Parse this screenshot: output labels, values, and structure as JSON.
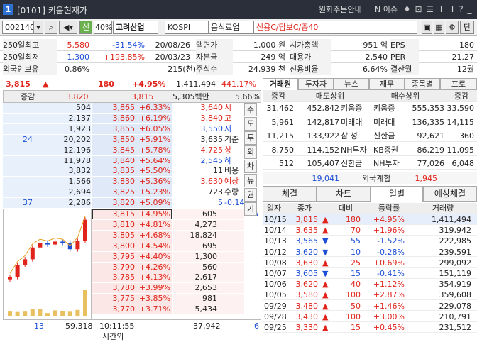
{
  "window": {
    "num": "1",
    "title": "[0101] 키움현재가",
    "notice": "원화주문안내",
    "news": "N 이슈"
  },
  "toolbar": {
    "code": "002140",
    "mode": "신",
    "pct": "40%",
    "name": "고려산업",
    "market": "KOSPI",
    "sector": "음식료업",
    "credit": "신용C/담보C/증40",
    "single": "단"
  },
  "info": {
    "r1": [
      "250일최고",
      "5,580",
      "-31.54%",
      "20/08/26",
      "액면가",
      "1,000 원",
      "시가총액",
      "951 억",
      "EPS",
      "180"
    ],
    "r2": [
      "250일최저",
      "1,300",
      "+193.85%",
      "20/03/23",
      "자본금",
      "249 억",
      "대용가",
      "2,540",
      "PER",
      "21.27"
    ],
    "r3": [
      "외국인보유",
      "0.86%",
      "215(천)",
      "주식수",
      "24,939 천",
      "신용비율",
      "6.64%",
      "결산월",
      "12월"
    ]
  },
  "summary": {
    "price": "3,815",
    "arrow": "▲",
    "diff": "180",
    "rate": "+4.95%",
    "volume": "1,411,494",
    "vr": "441.17%"
  },
  "obhdr": {
    "label": "증감",
    "p1": "3,820",
    "p2": "3,815",
    "amt": "5,305백만",
    "rate": "5.66%"
  },
  "asks": [
    {
      "chg": "",
      "qty": "504",
      "price": "3,865",
      "rate": "+6.33%"
    },
    {
      "chg": "",
      "qty": "2,137",
      "price": "3,860",
      "rate": "+6.19%"
    },
    {
      "chg": "",
      "qty": "1,923",
      "price": "3,855",
      "rate": "+6.05%"
    },
    {
      "chg": "24",
      "qty": "20,202",
      "price": "3,850",
      "rate": "+5.91%"
    },
    {
      "chg": "",
      "qty": "12,196",
      "price": "3,845",
      "rate": "+5.78%"
    },
    {
      "chg": "",
      "qty": "11,978",
      "price": "3,840",
      "rate": "+5.64%"
    },
    {
      "chg": "",
      "qty": "3,832",
      "price": "3,835",
      "rate": "+5.50%"
    },
    {
      "chg": "",
      "qty": "1,566",
      "price": "3,830",
      "rate": "+5.36%"
    },
    {
      "chg": "",
      "qty": "2,694",
      "price": "3,825",
      "rate": "+5.23%"
    },
    {
      "chg": "37",
      "qty": "2,286",
      "price": "3,820",
      "rate": "+5.09%"
    }
  ],
  "quote_info": [
    {
      "val": "3,640",
      "lbl": "시"
    },
    {
      "val": "3,840",
      "lbl": "고"
    },
    {
      "val": "3,550",
      "lbl": "저"
    },
    {
      "val": "3,635",
      "lbl": "기준"
    },
    {
      "val": "4,725",
      "lbl": "상"
    },
    {
      "val": "2,545",
      "lbl": "하"
    },
    {
      "val": "11",
      "lbl": "비용"
    },
    {
      "val": "3,630",
      "lbl": "예상"
    },
    {
      "val": "723",
      "lbl": "수량"
    },
    {
      "val": "5",
      "lbl": "-0.14%"
    }
  ],
  "vtabs": [
    "수",
    "도",
    "투",
    "외",
    "차",
    "뉴",
    "권",
    "기"
  ],
  "bids": [
    {
      "price": "3,815",
      "rate": "+4.95%",
      "qty": "605",
      "chg": "6"
    },
    {
      "price": "3,810",
      "rate": "+4.81%",
      "qty": "4,273",
      "chg": ""
    },
    {
      "price": "3,805",
      "rate": "+4.68%",
      "qty": "18,824",
      "chg": ""
    },
    {
      "price": "3,800",
      "rate": "+4.54%",
      "qty": "695",
      "chg": ""
    },
    {
      "price": "3,795",
      "rate": "+4.40%",
      "qty": "1,300",
      "chg": ""
    },
    {
      "price": "3,790",
      "rate": "+4.26%",
      "qty": "560",
      "chg": ""
    },
    {
      "price": "3,785",
      "rate": "+4.13%",
      "qty": "2,617",
      "chg": ""
    },
    {
      "price": "3,780",
      "rate": "+3.99%",
      "qty": "2,653",
      "chg": ""
    },
    {
      "price": "3,775",
      "rate": "+3.85%",
      "qty": "981",
      "chg": ""
    },
    {
      "price": "3,770",
      "rate": "+3.71%",
      "qty": "5,434",
      "chg": ""
    }
  ],
  "foot": {
    "a": "13",
    "b": "59,318",
    "time": "10:11:55",
    "label": "시간외",
    "c": "37,942",
    "d": "6"
  },
  "rtabs": [
    "거래원",
    "투자자",
    "뉴스",
    "재무",
    "종목별",
    "프로"
  ],
  "broker_hdr": [
    "증감",
    "매도상위",
    "매수상위",
    "증감"
  ],
  "brokers": [
    {
      "c1": "31,462",
      "s": "452,842",
      "sn": "키움증",
      "bn": "키움증",
      "b": "555,353",
      "c2": "33,590"
    },
    {
      "c1": "5,961",
      "s": "142,817",
      "sn": "미래대",
      "bn": "미래대",
      "b": "136,335",
      "c2": "14,115"
    },
    {
      "c1": "11,215",
      "s": "133,922",
      "sn": "삼 성",
      "bn": "신한금",
      "b": "92,621",
      "c2": "360"
    },
    {
      "c1": "8,750",
      "s": "114,152",
      "sn": "NH투자",
      "bn": "KB증권",
      "b": "86,219",
      "c2": "11,095"
    },
    {
      "c1": "512",
      "s": "105,407",
      "sn": "신한금",
      "bn": "NH투자",
      "b": "77,026",
      "c2": "6,048"
    }
  ],
  "foreign": {
    "left": "19,041",
    "label": "외국계합",
    "right": "1,945"
  },
  "mtabs": [
    "체결",
    "차트",
    "일별",
    "예상체결"
  ],
  "daily_hdr": [
    "일자",
    "종가",
    "대비",
    "등락률",
    "거래량"
  ],
  "daily": [
    {
      "d": "10/15",
      "p": "3,815",
      "a": "▲",
      "v": "180",
      "r": "+4.95%",
      "q": "1,411,494",
      "up": true
    },
    {
      "d": "10/14",
      "p": "3,635",
      "a": "▲",
      "v": "70",
      "r": "+1.96%",
      "q": "319,942",
      "up": true
    },
    {
      "d": "10/13",
      "p": "3,565",
      "a": "▼",
      "v": "55",
      "r": "-1.52%",
      "q": "222,985",
      "up": false
    },
    {
      "d": "10/12",
      "p": "3,620",
      "a": "▼",
      "v": "10",
      "r": "-0.28%",
      "q": "239,591",
      "up": false
    },
    {
      "d": "10/08",
      "p": "3,630",
      "a": "▲",
      "v": "25",
      "r": "+0.69%",
      "q": "299,092",
      "up": true
    },
    {
      "d": "10/07",
      "p": "3,605",
      "a": "▼",
      "v": "15",
      "r": "-0.41%",
      "q": "151,119",
      "up": false
    },
    {
      "d": "10/06",
      "p": "3,620",
      "a": "▲",
      "v": "40",
      "r": "+1.12%",
      "q": "354,919",
      "up": true
    },
    {
      "d": "10/05",
      "p": "3,580",
      "a": "▲",
      "v": "100",
      "r": "+2.87%",
      "q": "359,608",
      "up": true
    },
    {
      "d": "09/29",
      "p": "3,480",
      "a": "▲",
      "v": "50",
      "r": "+1.46%",
      "q": "229,078",
      "up": true
    },
    {
      "d": "09/28",
      "p": "3,430",
      "a": "▲",
      "v": "100",
      "r": "+3.00%",
      "q": "210,791",
      "up": true
    },
    {
      "d": "09/25",
      "p": "3,330",
      "a": "▲",
      "v": "15",
      "r": "+0.45%",
      "q": "231,512",
      "up": true
    }
  ],
  "chart_data": {
    "type": "candlestick",
    "x": [
      "09/25",
      "09/28",
      "09/29",
      "10/05",
      "10/06",
      "10/07",
      "10/08",
      "10/12",
      "10/13",
      "10/14",
      "10/15"
    ],
    "close": [
      3330,
      3430,
      3480,
      3580,
      3620,
      3605,
      3630,
      3620,
      3565,
      3635,
      3815
    ]
  }
}
